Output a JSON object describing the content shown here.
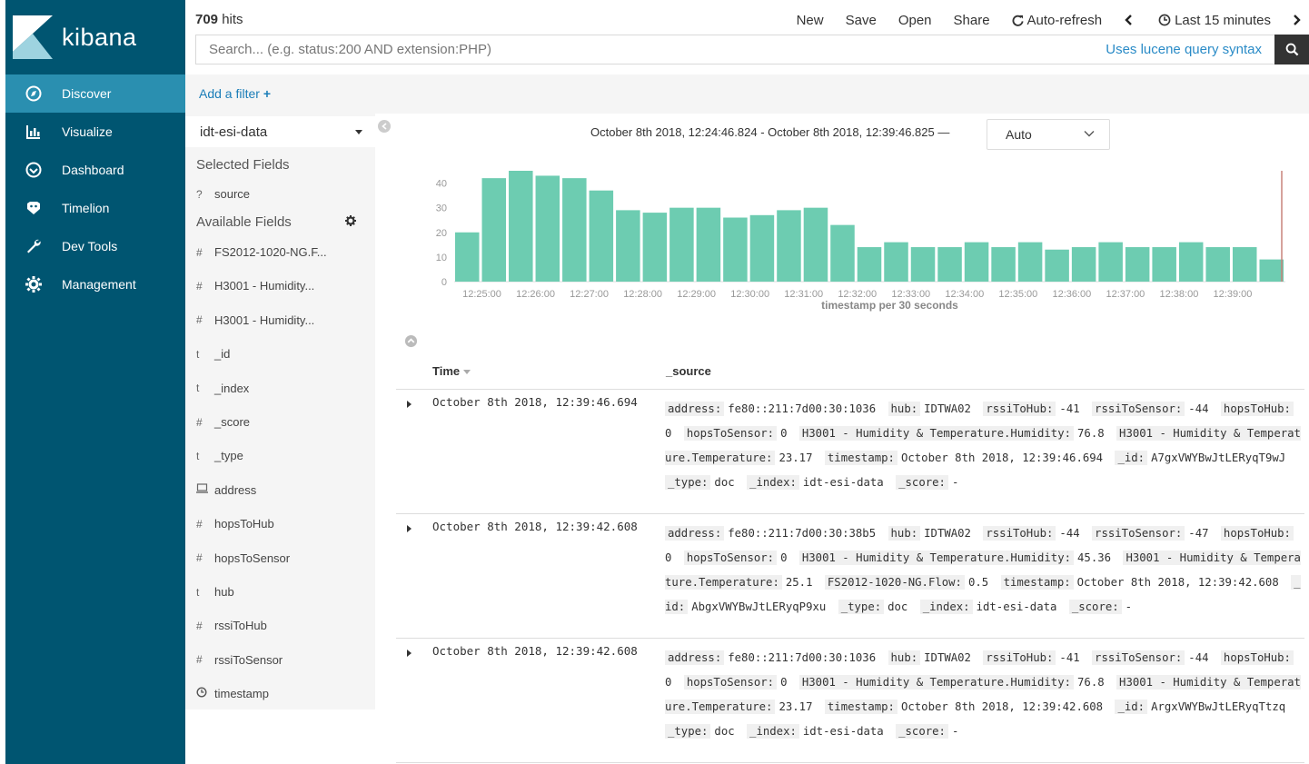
{
  "brand": {
    "name": "kibana"
  },
  "nav": [
    {
      "label": "Discover",
      "icon": "compass-icon",
      "active": true
    },
    {
      "label": "Visualize",
      "icon": "bar-chart-icon"
    },
    {
      "label": "Dashboard",
      "icon": "dashboard-icon"
    },
    {
      "label": "Timelion",
      "icon": "timelion-icon"
    },
    {
      "label": "Dev Tools",
      "icon": "wrench-icon"
    },
    {
      "label": "Management",
      "icon": "gear-icon"
    }
  ],
  "topbar": {
    "hits_count": "709",
    "hits_label": " hits",
    "menu": {
      "new": "New",
      "save": "Save",
      "open": "Open",
      "share": "Share",
      "auto_refresh": "Auto-refresh",
      "time_range": "Last 15 minutes"
    },
    "search_placeholder": "Search... (e.g. status:200 AND extension:PHP)",
    "lucene_link": "Uses lucene query syntax"
  },
  "filterbar": {
    "add_filter": "Add a filter",
    "add_symbol": "+"
  },
  "sidebar": {
    "index_pattern": "idt-esi-data",
    "selected_title": "Selected Fields",
    "selected_fields": [
      {
        "type": "?",
        "name": "source"
      }
    ],
    "available_title": "Available Fields",
    "available_fields": [
      {
        "type": "#",
        "name": "FS2012-1020-NG.F..."
      },
      {
        "type": "#",
        "name": "H3001 - Humidity..."
      },
      {
        "type": "#",
        "name": "H3001 - Humidity..."
      },
      {
        "type": "t",
        "name": "_id"
      },
      {
        "type": "t",
        "name": "_index"
      },
      {
        "type": "#",
        "name": "_score"
      },
      {
        "type": "t",
        "name": "_type"
      },
      {
        "type": "ip",
        "name": "address"
      },
      {
        "type": "#",
        "name": "hopsToHub"
      },
      {
        "type": "#",
        "name": "hopsToSensor"
      },
      {
        "type": "t",
        "name": "hub"
      },
      {
        "type": "#",
        "name": "rssiToHub"
      },
      {
        "type": "#",
        "name": "rssiToSensor"
      },
      {
        "type": "clock",
        "name": "timestamp"
      }
    ]
  },
  "main": {
    "time_range_text": "October 8th 2018, 12:24:46.824 - October 8th 2018, 12:39:46.825 —",
    "interval": "Auto",
    "col_time": "Time",
    "col_source": "_source"
  },
  "chart_data": {
    "type": "bar",
    "xlabel": "timestamp per 30 seconds",
    "ylabel": "",
    "ylim": [
      0,
      45
    ],
    "yticks": [
      0,
      10,
      20,
      30,
      40
    ],
    "x_tick_labels": [
      "12:25:00",
      "12:26:00",
      "12:27:00",
      "12:28:00",
      "12:29:00",
      "12:30:00",
      "12:31:00",
      "12:32:00",
      "12:33:00",
      "12:34:00",
      "12:35:00",
      "12:36:00",
      "12:37:00",
      "12:38:00",
      "12:39:00"
    ],
    "values": [
      20,
      42,
      45,
      43,
      42,
      37,
      29,
      28,
      30,
      30,
      26,
      27,
      29,
      30,
      23,
      14,
      16,
      14,
      14,
      16,
      14,
      16,
      13,
      14,
      16,
      14,
      14,
      16,
      14,
      14,
      9
    ],
    "bar_color": "#6dccb1"
  },
  "rows": [
    {
      "time": "October 8th 2018, 12:39:46.694",
      "fields": [
        [
          "address:",
          "fe80::211:7d00:30:1036"
        ],
        [
          "hub:",
          "IDTWA02"
        ],
        [
          "rssiToHub:",
          "-41"
        ],
        [
          "rssiToSensor:",
          "-44"
        ],
        [
          "hopsToHub:",
          "0"
        ],
        [
          "hopsToSensor:",
          "0"
        ],
        [
          "H3001 - Humidity & Temperature.Humidity:",
          "76.8"
        ],
        [
          "H3001 - Humidity & Temperature.Temperature:",
          "23.17"
        ],
        [
          "timestamp:",
          "October 8th 2018, 12:39:46.694"
        ],
        [
          "_id:",
          "A7gxVWYBwJtLERyqT9wJ"
        ],
        [
          "_type:",
          "doc"
        ],
        [
          "_index:",
          "idt-esi-data"
        ],
        [
          "_score:",
          "-"
        ]
      ]
    },
    {
      "time": "October 8th 2018, 12:39:42.608",
      "fields": [
        [
          "address:",
          "fe80::211:7d00:30:38b5"
        ],
        [
          "hub:",
          "IDTWA02"
        ],
        [
          "rssiToHub:",
          "-44"
        ],
        [
          "rssiToSensor:",
          "-47"
        ],
        [
          "hopsToHub:",
          "0"
        ],
        [
          "hopsToSensor:",
          "0"
        ],
        [
          "H3001 - Humidity & Temperature.Humidity:",
          "45.36"
        ],
        [
          "H3001 - Humidity & Temperature.Temperature:",
          "25.1"
        ],
        [
          "FS2012-1020-NG.Flow:",
          "0.5"
        ],
        [
          "timestamp:",
          "October 8th 2018, 12:39:42.608"
        ],
        [
          "_id:",
          "AbgxVWYBwJtLERyqP9xu"
        ],
        [
          "_type:",
          "doc"
        ],
        [
          "_index:",
          "idt-esi-data"
        ],
        [
          "_score:",
          "-"
        ]
      ]
    },
    {
      "time": "October 8th 2018, 12:39:42.608",
      "fields": [
        [
          "address:",
          "fe80::211:7d00:30:1036"
        ],
        [
          "hub:",
          "IDTWA02"
        ],
        [
          "rssiToHub:",
          "-41"
        ],
        [
          "rssiToSensor:",
          "-44"
        ],
        [
          "hopsToHub:",
          "0"
        ],
        [
          "hopsToSensor:",
          "0"
        ],
        [
          "H3001 - Humidity & Temperature.Humidity:",
          "76.8"
        ],
        [
          "H3001 - Humidity & Temperature.Temperature:",
          "23.17"
        ],
        [
          "timestamp:",
          "October 8th 2018, 12:39:42.608"
        ],
        [
          "_id:",
          "ArgxVWYBwJtLERyqTtzq"
        ],
        [
          "_type:",
          "doc"
        ],
        [
          "_index:",
          "idt-esi-data"
        ],
        [
          "_score:",
          "-"
        ]
      ]
    }
  ]
}
